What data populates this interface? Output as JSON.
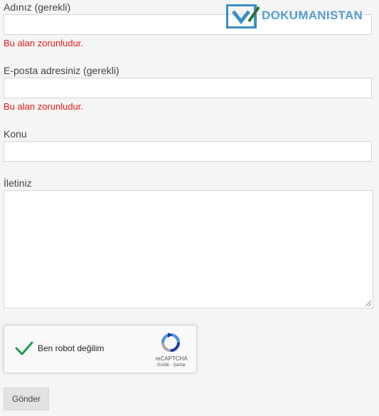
{
  "form": {
    "name": {
      "label": "Adınız (gerekli)",
      "value": "",
      "error": "Bu alan zorunludur."
    },
    "email": {
      "label": "E-posta adresiniz (gerekli)",
      "value": "",
      "error": "Bu alan zorunludur."
    },
    "subject": {
      "label": "Konu",
      "value": ""
    },
    "message": {
      "label": "İletiniz",
      "value": ""
    },
    "submit_label": "Gönder"
  },
  "recaptcha": {
    "label": "Ben robot değilim",
    "checked": true,
    "brand": "reCAPTCHA",
    "links": "Gizlilik - Şartlar",
    "check_color": "#1e9a4d",
    "icon": "recaptcha-logo-icon"
  },
  "watermark": {
    "text": "DOKUMANISTAN",
    "color": "#3a8fc4"
  },
  "colors": {
    "background": "#f5f5f5",
    "error": "#e21b1b",
    "button_bg": "#e2e2e2"
  }
}
